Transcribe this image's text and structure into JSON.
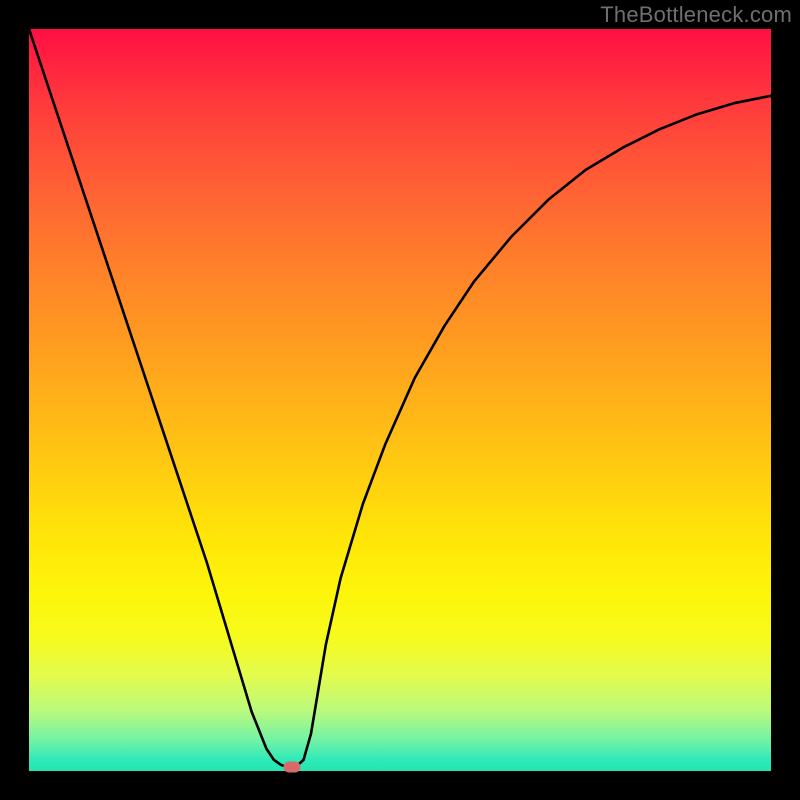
{
  "attribution": "TheBottleneck.com",
  "chart_data": {
    "type": "line",
    "title": "",
    "xlabel": "",
    "ylabel": "",
    "xlim": [
      0,
      100
    ],
    "ylim": [
      0,
      100
    ],
    "x": [
      0,
      3,
      6,
      9,
      12,
      15,
      18,
      21,
      24,
      27,
      30,
      32,
      33,
      34,
      35,
      36,
      37,
      38,
      39,
      40,
      42,
      45,
      48,
      52,
      56,
      60,
      65,
      70,
      75,
      80,
      85,
      90,
      95,
      100
    ],
    "values": [
      100,
      91,
      82,
      73,
      64,
      55,
      46,
      37,
      28,
      18,
      8,
      3,
      1.5,
      0.8,
      0.5,
      0.6,
      1.5,
      5,
      11,
      17,
      26,
      36,
      44,
      53,
      60,
      66,
      72,
      77,
      81,
      84,
      86.5,
      88.5,
      90,
      91
    ],
    "marker": {
      "x": 35.5,
      "y": 0.5
    },
    "grid": false,
    "legend": false
  },
  "colors": {
    "frame": "#000000",
    "curve": "#000000",
    "marker": "#d96a6a",
    "attribution": "#6f6f6f"
  }
}
